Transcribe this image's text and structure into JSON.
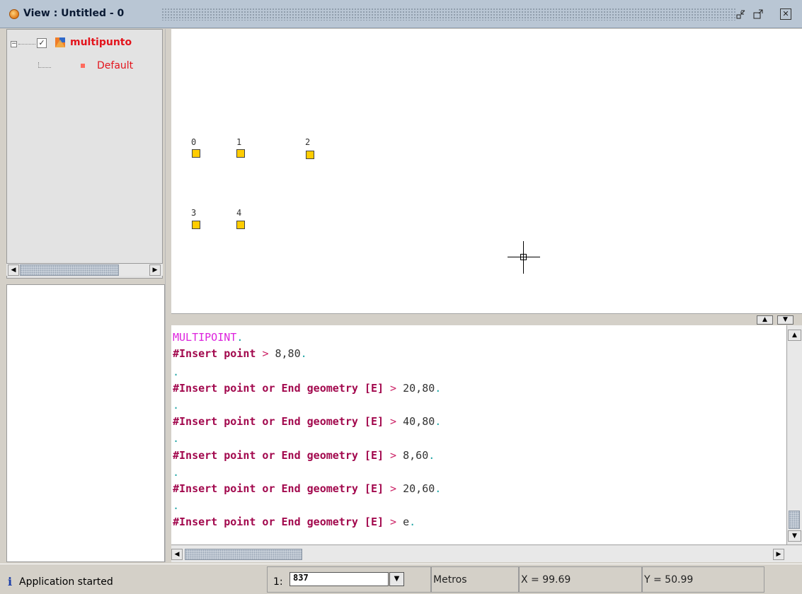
{
  "window": {
    "title": "View : Untitled - 0",
    "buttons": {
      "minimize": "▫",
      "restore": "▫",
      "close": "✕"
    }
  },
  "toc": {
    "layer": {
      "name": "multipunto",
      "checked": true,
      "icon": "layer-icon",
      "expander": "−"
    },
    "legend": {
      "label": "Default",
      "swatch_color": "#ff6b5e"
    }
  },
  "map": {
    "point_color": "#ffcc00",
    "points": [
      {
        "label": "0"
      },
      {
        "label": "1"
      },
      {
        "label": "2"
      },
      {
        "label": "3"
      },
      {
        "label": "4"
      }
    ]
  },
  "console": {
    "command": "MULTIPOINT",
    "lines": [
      {
        "prompt": "#Insert point",
        "value": "8,80"
      },
      {
        "prompt": "#Insert point or End geometry [E]",
        "value": "20,80"
      },
      {
        "prompt": "#Insert point or End geometry [E]",
        "value": "40,80"
      },
      {
        "prompt": "#Insert point or End geometry [E]",
        "value": "8,60"
      },
      {
        "prompt": "#Insert point or End geometry [E]",
        "value": "20,60"
      },
      {
        "prompt": "#Insert point or End geometry [E]",
        "value": "e"
      }
    ],
    "arrow": ">",
    "dot": "."
  },
  "statusbar": {
    "message": "Application started",
    "scale_prefix": "1:",
    "scale_value": "837",
    "units": "Metros",
    "x": "X = 99.69",
    "y": "Y = 50.99"
  }
}
